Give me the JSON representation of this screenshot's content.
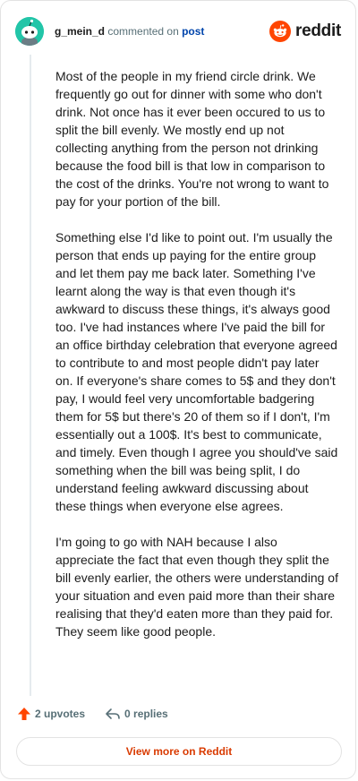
{
  "header": {
    "username": "g_mein_d",
    "action_text": "commented on",
    "post_link": "post",
    "brand": "reddit"
  },
  "comment": {
    "paragraphs": [
      "Most of the people in my friend circle drink. We frequently go out for dinner with some who don't drink. Not once has it ever been occured to us to split the bill evenly. We mostly end up not collecting anything from the person not drinking because the food bill is that low in comparison to the cost of the drinks. You're not wrong to want to pay for your portion of the bill.",
      "Something else I'd like to point out. I'm usually the person that ends up paying for the entire group and let them pay me back later. Something I've learnt along the way is that even though it's awkward to discuss these things, it's always good too. I've had instances where I've paid the bill for an office birthday celebration that everyone agreed to contribute to and most people didn't pay later on. If everyone's share comes to 5$ and they don't pay, I would feel very uncomfortable badgering them for 5$ but there's 20 of them so if I don't, I'm essentially out a 100$. It's best to communicate, and timely. Even though I agree you should've said something when the bill was being split, I do understand feeling awkward discussing about these things when everyone else agrees.",
      "I'm going to go with NAH because I also appreciate the fact that even though they split the bill evenly earlier, the others were understanding of your situation and even paid more than their share realising that they'd eaten more than they paid for. They seem like good people."
    ]
  },
  "actions": {
    "upvotes": "2 upvotes",
    "replies": "0 replies"
  },
  "footer": {
    "view_more": "View more on Reddit"
  },
  "colors": {
    "accent": "#d93a00",
    "upvote": "#ff4500",
    "avatar": "#22c5a8",
    "link": "#0045ac"
  }
}
